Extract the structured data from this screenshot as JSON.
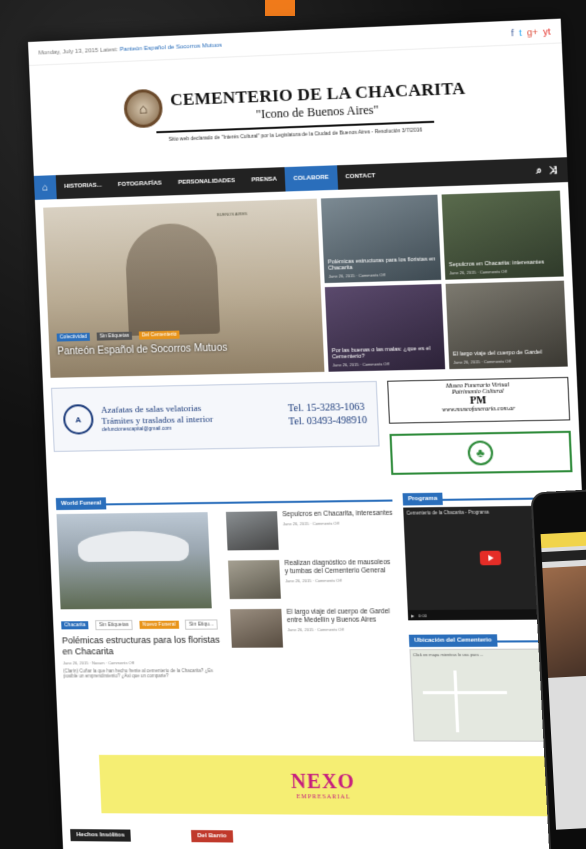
{
  "topbar": {
    "date": "Monday, July 13, 2015",
    "latest_label": "Latest:",
    "latest_text": "Panteón Español de Socorros Mutuos"
  },
  "social": [
    "f",
    "t",
    "g+",
    "yt"
  ],
  "masthead": {
    "title": "CEMENTERIO DE LA CHACARITA",
    "subtitle": "\"Icono de Buenos Aires\"",
    "declaration": "Sitio web declarado de \"Interés Cultural\" por la Legislatura de la Ciudad de Buenos Aires - Resolución 3/7/2016"
  },
  "nav": {
    "items": [
      "HISTORIAS...",
      "FOTOGRAFÍAS",
      "PERSONALIDADES",
      "PRENSA",
      "COLABORE",
      "CONTACT"
    ],
    "active_index": 4
  },
  "hero": {
    "main": {
      "tags": [
        "Colectividad",
        "Sin Etiquetas",
        "Del Cementerio"
      ],
      "title": "Panteón Español de Socorros Mutuos",
      "postcard": "BUENOS AIRES"
    },
    "tiles": [
      {
        "title": "Polémicas estructuras para los floristas en Chacarita",
        "meta": "June 26, 2015 · Comments Off"
      },
      {
        "title": "Sepulcros en Chacarita: interesantes",
        "meta": "June 26, 2015 · Comments Off"
      },
      {
        "title": "Por las buenas o las malas: ¿que es el Cementerio?",
        "meta": "June 26, 2015 · Comments Off"
      },
      {
        "title": "El largo viaje del cuerpo de Gardel",
        "meta": "June 26, 2015 · Comments Off"
      }
    ]
  },
  "ad": {
    "logo": "A",
    "line1": "Azafatas de salas velatorias",
    "line2": "Trámites y traslados al interior",
    "email": "defuncionescapital@gmail.com",
    "phone1": "Tel. 15-3283-1063",
    "phone2": "Tel. 03493-498910"
  },
  "side_ad1": {
    "title": "Museo Funerario Virtual",
    "sub": "Patrimonio Cultural",
    "logo": "PM",
    "url": "www.museofunerario.com.ar"
  },
  "side_ad2_icon": "tree-icon",
  "world_funeral": {
    "heading": "World Funeral",
    "lead": {
      "tags": [
        "Chacarita",
        "Sin Etiquetas",
        "Nuevo Funeral",
        "Sin Etiqu..."
      ],
      "title": "Polémicas estructuras para los floristas en Chacarita",
      "meta": "June 26, 2015 · Novum · Comments Off",
      "excerpt": "(Clarín) Cuñar la que han hecho frente al cementerio de la Chacarita? ¿Es posible un emprendimiento? ¿Así que un comparte?"
    },
    "items": [
      {
        "title": "Sepulcros en Chacarita, interesantes",
        "meta": "June 26, 2015 · Comments Off"
      },
      {
        "title": "Realizan diagnóstico de mausoleos y tumbas del Cementerio General",
        "meta": "June 26, 2015 · Comments Off"
      },
      {
        "title": "El largo viaje del cuerpo de Gardel entre Medellín y Buenos Aires",
        "meta": "June 26, 2015 · Comments Off"
      }
    ]
  },
  "sidebar": {
    "programa_heading": "Programa",
    "video_title": "Cementerio de la Chacarita - Programa",
    "video_time": "0:00",
    "map_heading": "Ubicación del Cementerio",
    "map_hint": "Click en mapa mientras lo usa para ..."
  },
  "nexo": {
    "word": "NEXO",
    "sub": "EMPRESARIAL"
  },
  "bottom": {
    "left": "Hechos Insólitos",
    "right": "Del Barrio"
  },
  "colors": {
    "accent": "#2a6ebb",
    "nav": "#222222",
    "orange": "#e8941a",
    "nexo_bg": "#f5ee73",
    "nexo_text": "#c61d7e"
  }
}
